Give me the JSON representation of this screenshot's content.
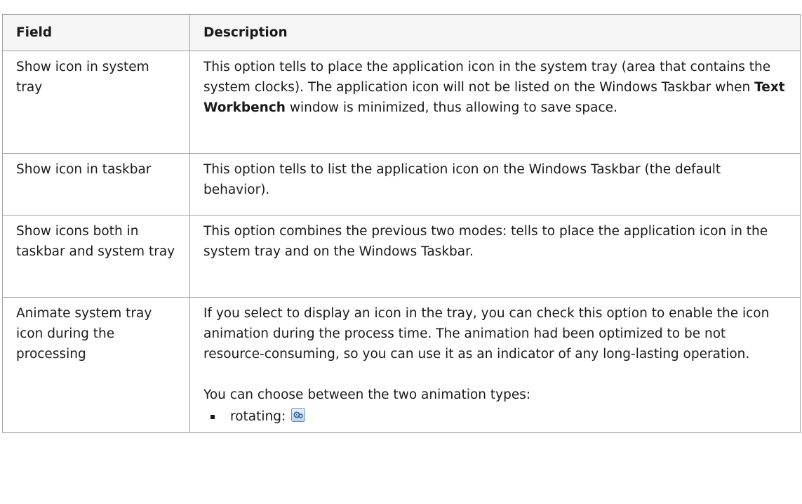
{
  "table": {
    "headers": {
      "field": "Field",
      "description": "Description"
    },
    "rows": [
      {
        "field": "Show icon in system tray",
        "desc_before": "This option tells to place the application icon in the system tray (area that contains the system clocks). The application icon will not be listed on the Windows Taskbar when ",
        "desc_bold": "Text Workbench",
        "desc_after": " window is minimized, thus allowing to save space."
      },
      {
        "field": "Show icon in taskbar",
        "desc": "This option tells to list the application icon on the Windows Taskbar (the default behavior)."
      },
      {
        "field": "Show icons both in taskbar and system tray",
        "desc": "This option combines the previous two modes: tells to place the application icon in the system tray and on the Windows Taskbar."
      },
      {
        "field": "Animate system tray icon during the processing",
        "desc_p1": "If you select to display an icon in the tray, you can check this option to enable the icon animation during the process time. The animation had been optimized to be not resource-consuming, so you can use it as an indicator of any long-lasting operation.",
        "desc_p2": "You can choose between the two animation types:",
        "animation_types": [
          {
            "label": "rotating:",
            "icon": "rotating-gears-icon"
          }
        ]
      }
    ]
  }
}
